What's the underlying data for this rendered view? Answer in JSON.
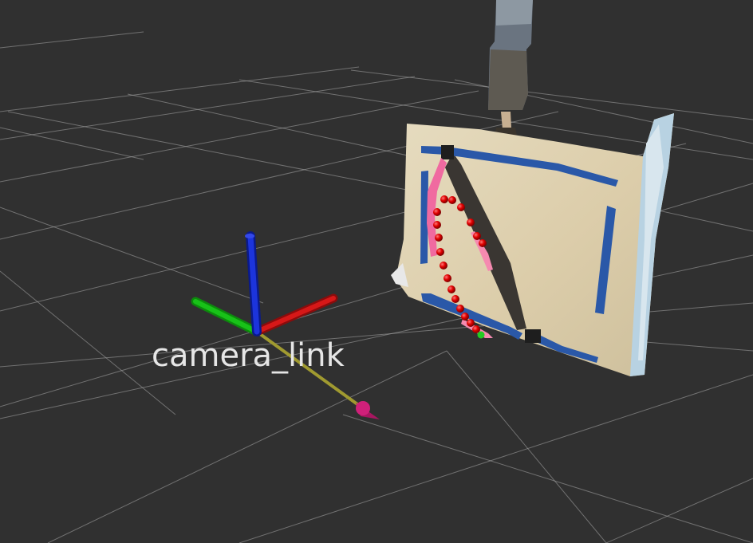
{
  "viewer": {
    "frame_label": "camera_link",
    "colors": {
      "background": "#303030",
      "grid": "#a8a8a8",
      "axis_x": "#c81414",
      "axis_y": "#14b414",
      "axis_z": "#1428d2",
      "arrow_shaft": "#a09a30",
      "arrow_head": "#d0207a",
      "board": "#dccdaa",
      "board_edge": "#b8d2e2",
      "tape": "#2a58a8",
      "path_points": "#dd0000",
      "goal_point": "#22cc22",
      "pink_stroke": "#f06aa0"
    },
    "icons": [
      "axes-marker-icon",
      "pose-arrow-icon"
    ]
  }
}
